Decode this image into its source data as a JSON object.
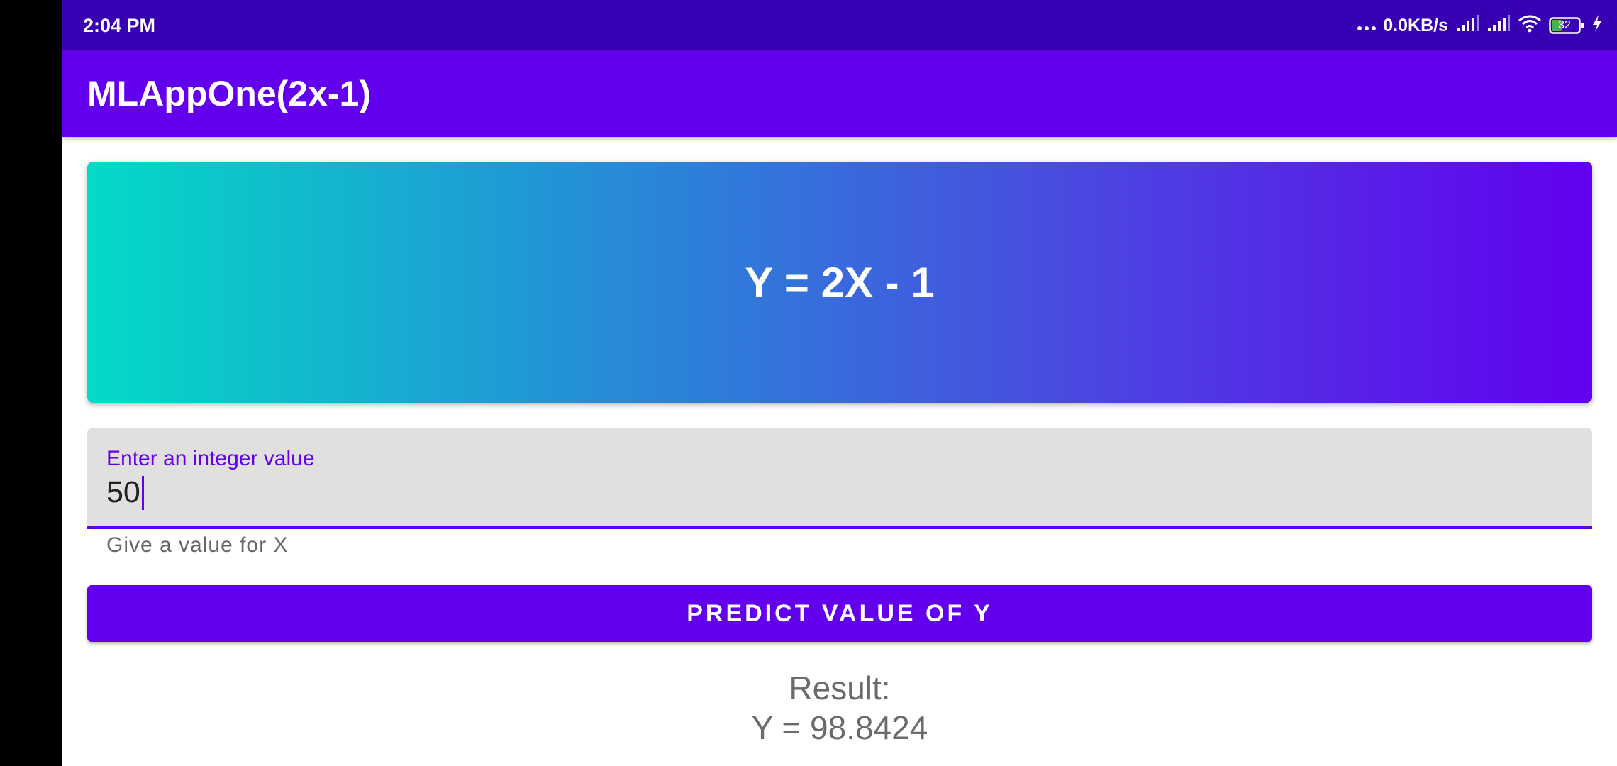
{
  "status_bar": {
    "time": "2:04 PM",
    "network_speed": "0.0KB/s",
    "battery_level": "32",
    "icons": [
      "more-dots-icon",
      "signal-icon",
      "signal-icon",
      "wifi-icon",
      "battery-icon",
      "charging-icon"
    ]
  },
  "app_bar": {
    "title": "MLAppOne(2x-1)"
  },
  "formula_card": {
    "text": "Y = 2X - 1",
    "gradient_start": "#03dac5",
    "gradient_end": "#6200ee"
  },
  "input": {
    "label": "Enter an integer value",
    "value": "50",
    "helper": "Give a value for X"
  },
  "predict_button": {
    "label": "PREDICT VALUE OF Y"
  },
  "result": {
    "label": "Result:",
    "value": "Y = 98.8424"
  },
  "colors": {
    "primary": "#6200ee",
    "primary_dark": "#3700b3",
    "input_background": "#e0e0e0",
    "muted_text": "#6b6b6b"
  }
}
